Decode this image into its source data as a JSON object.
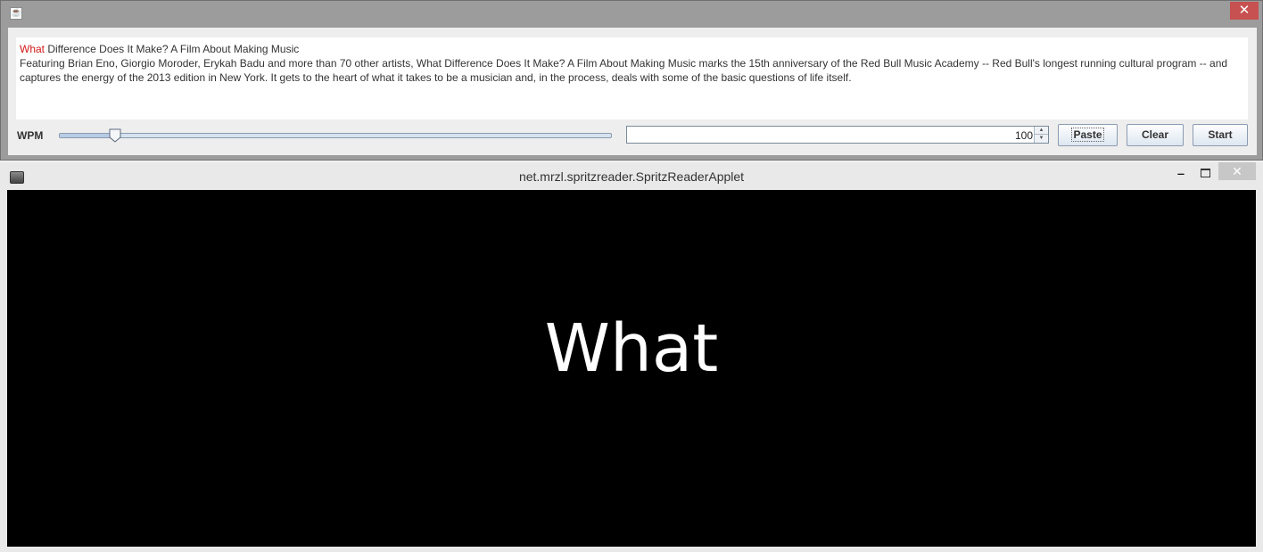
{
  "top_window": {
    "icon": "java-icon",
    "close_icon": "close-icon",
    "close_glyph": "✕",
    "text": {
      "title_highlight": "What",
      "title_rest": " Difference Does It Make? A Film About Making Music",
      "body": "Featuring Brian Eno, Giorgio Moroder, Erykah Badu and more than 70 other artists, What Difference Does It Make? A Film About Making Music marks the 15th anniversary of the Red Bull Music Academy -- Red Bull's longest running cultural program -- and captures the energy of the 2013 edition in New York. It gets to the heart of what it takes to be a musician and, in the process, deals with some of the basic questions of life itself.",
      "highlight_color": "#d01818"
    },
    "wpm_label": "WPM",
    "slider": {
      "min": 0,
      "max": 1000,
      "value": 100
    },
    "spinner_value": "100",
    "buttons": {
      "paste": "Paste",
      "clear": "Clear",
      "start": "Start"
    }
  },
  "applet_window": {
    "title": "net.mrzl.spritzreader.SpritzReaderApplet",
    "min_glyph": "‒",
    "close_glyph": "✕",
    "current_word": "What",
    "background_color": "#000000",
    "word_color": "#ffffff"
  }
}
